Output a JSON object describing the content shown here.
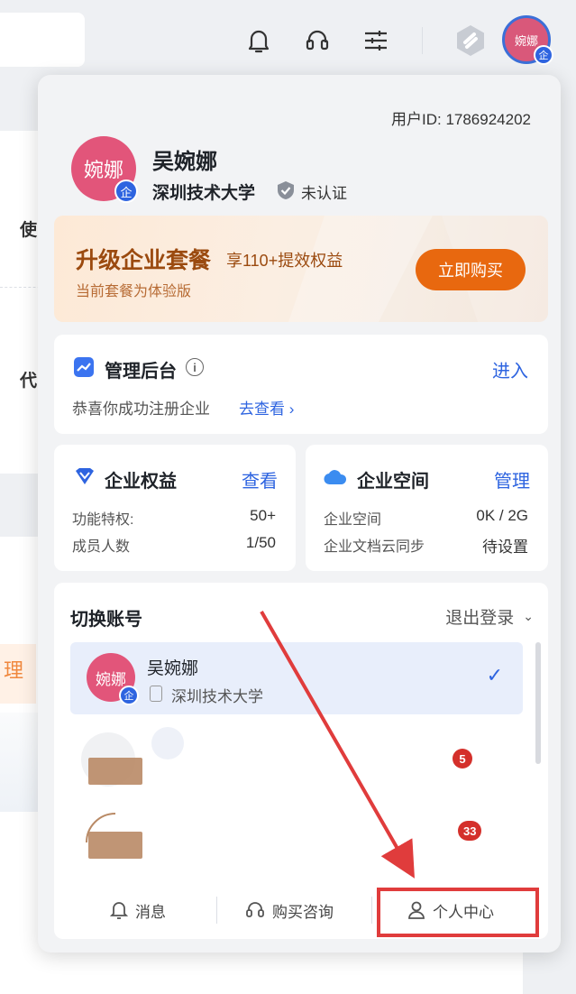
{
  "topbar": {
    "icons": [
      "bell-icon",
      "headset-icon",
      "sliders-icon",
      "app-logo-icon"
    ],
    "avatar_text": "婉娜",
    "avatar_badge": "企"
  },
  "background": {
    "chars": [
      "使",
      "代"
    ],
    "orange_text": "理"
  },
  "panel": {
    "user_id": "用户ID: 1786924202",
    "avatar_text": "婉娜",
    "avatar_badge": "企",
    "name": "吴婉娜",
    "org": "深圳技术大学",
    "verify_status": "未认证",
    "upgrade": {
      "title": "升级企业套餐",
      "subtitle": "享110+提效权益",
      "plan": "当前套餐为体验版",
      "button": "立即购买"
    },
    "admin": {
      "title": "管理后台",
      "enter": "进入",
      "note": "恭喜你成功注册企业",
      "view": "去查看"
    },
    "equity": {
      "title": "企业权益",
      "action": "查看",
      "rows": [
        {
          "label": "功能特权:",
          "value": "50+"
        },
        {
          "label": "成员人数",
          "value": "1/50"
        }
      ]
    },
    "space": {
      "title": "企业空间",
      "action": "管理",
      "rows": [
        {
          "label": "企业空间",
          "value": "0K / 2G"
        },
        {
          "label": "企业文档云同步",
          "value": "待设置"
        }
      ]
    },
    "switch": {
      "title": "切换账号",
      "logout": "退出登录",
      "accounts": [
        {
          "name": "吴婉娜",
          "org": "深圳技术大学",
          "avatar_text": "婉娜",
          "badge": "企",
          "selected": true
        },
        {
          "badge_count": "5"
        },
        {
          "badge_count": "33"
        }
      ]
    },
    "footer": {
      "messages": "消息",
      "consult": "购买咨询",
      "personal_center": "个人中心"
    }
  },
  "colors": {
    "accent": "#2e64e0",
    "buy_button": "#e8680f",
    "annotation": "#e03c3c",
    "badge": "#d4302b"
  }
}
